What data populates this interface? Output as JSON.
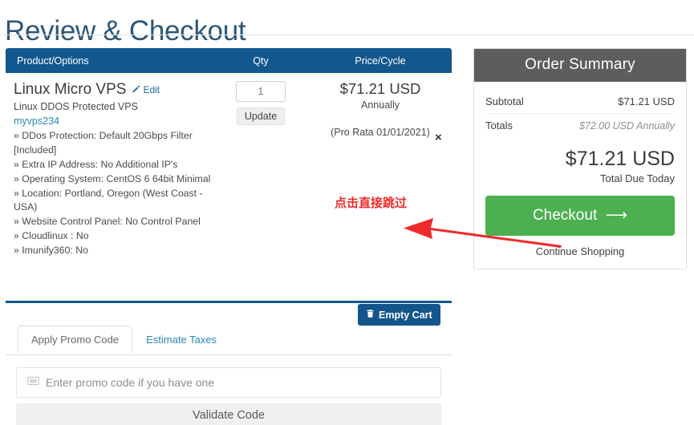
{
  "page": {
    "title": "Review & Checkout"
  },
  "cart": {
    "columns": {
      "product": "Product/Options",
      "qty": "Qty",
      "price": "Price/Cycle"
    },
    "item": {
      "name": "Linux Micro VPS",
      "edit_label": "Edit",
      "edit_icon": "pencil-icon",
      "description": "Linux DDOS Protected VPS",
      "domain": "myvps234",
      "options": [
        "» DDos Protection: Default 20Gbps Filter [Included]",
        "» Extra IP Address: No Additional IP's",
        "» Operating System: CentOS 6 64bit Minimal",
        "» Location: Portland, Oregon (West Coast - USA)",
        "» Website Control Panel: No Control Panel",
        "» Cloudlinux : No",
        "» Imunify360: No"
      ],
      "qty_value": "1",
      "update_label": "Update",
      "price": "$71.21 USD",
      "billing_cycle": "Annually",
      "pro_rata": "(Pro Rata 01/01/2021)",
      "remove_icon": "close-icon",
      "remove_label": "×"
    },
    "empty_cart_label": "Empty Cart",
    "empty_cart_icon": "trash-icon"
  },
  "tabs": [
    {
      "label": "Apply Promo Code",
      "active": true
    },
    {
      "label": "Estimate Taxes",
      "active": false
    }
  ],
  "promo": {
    "icon": "ticket-icon",
    "placeholder": "Enter promo code if you have one",
    "value": "",
    "validate_label": "Validate Code"
  },
  "summary": {
    "heading": "Order Summary",
    "rows": [
      {
        "label": "Subtotal",
        "value": "$71.21 USD",
        "muted": false
      },
      {
        "label": "Totals",
        "value": "$72.00 USD Annually",
        "muted": true
      }
    ],
    "total_amount": "$71.21 USD",
    "total_label": "Total Due Today",
    "checkout_label": "Checkout",
    "checkout_icon": "arrow-right-icon",
    "continue_label": "Continue Shopping"
  },
  "annotation": {
    "text": "点击直接跳过",
    "arrow_icon": "arrow-left-icon",
    "color": "#ef2b2b"
  },
  "colors": {
    "header_blue": "#12578d",
    "summary_gray": "#5d5d5d",
    "checkout_green": "#4caf50",
    "title_blue": "#2c5777",
    "link_blue": "#2b87b5",
    "annotation_red": "#ef2b2b"
  }
}
